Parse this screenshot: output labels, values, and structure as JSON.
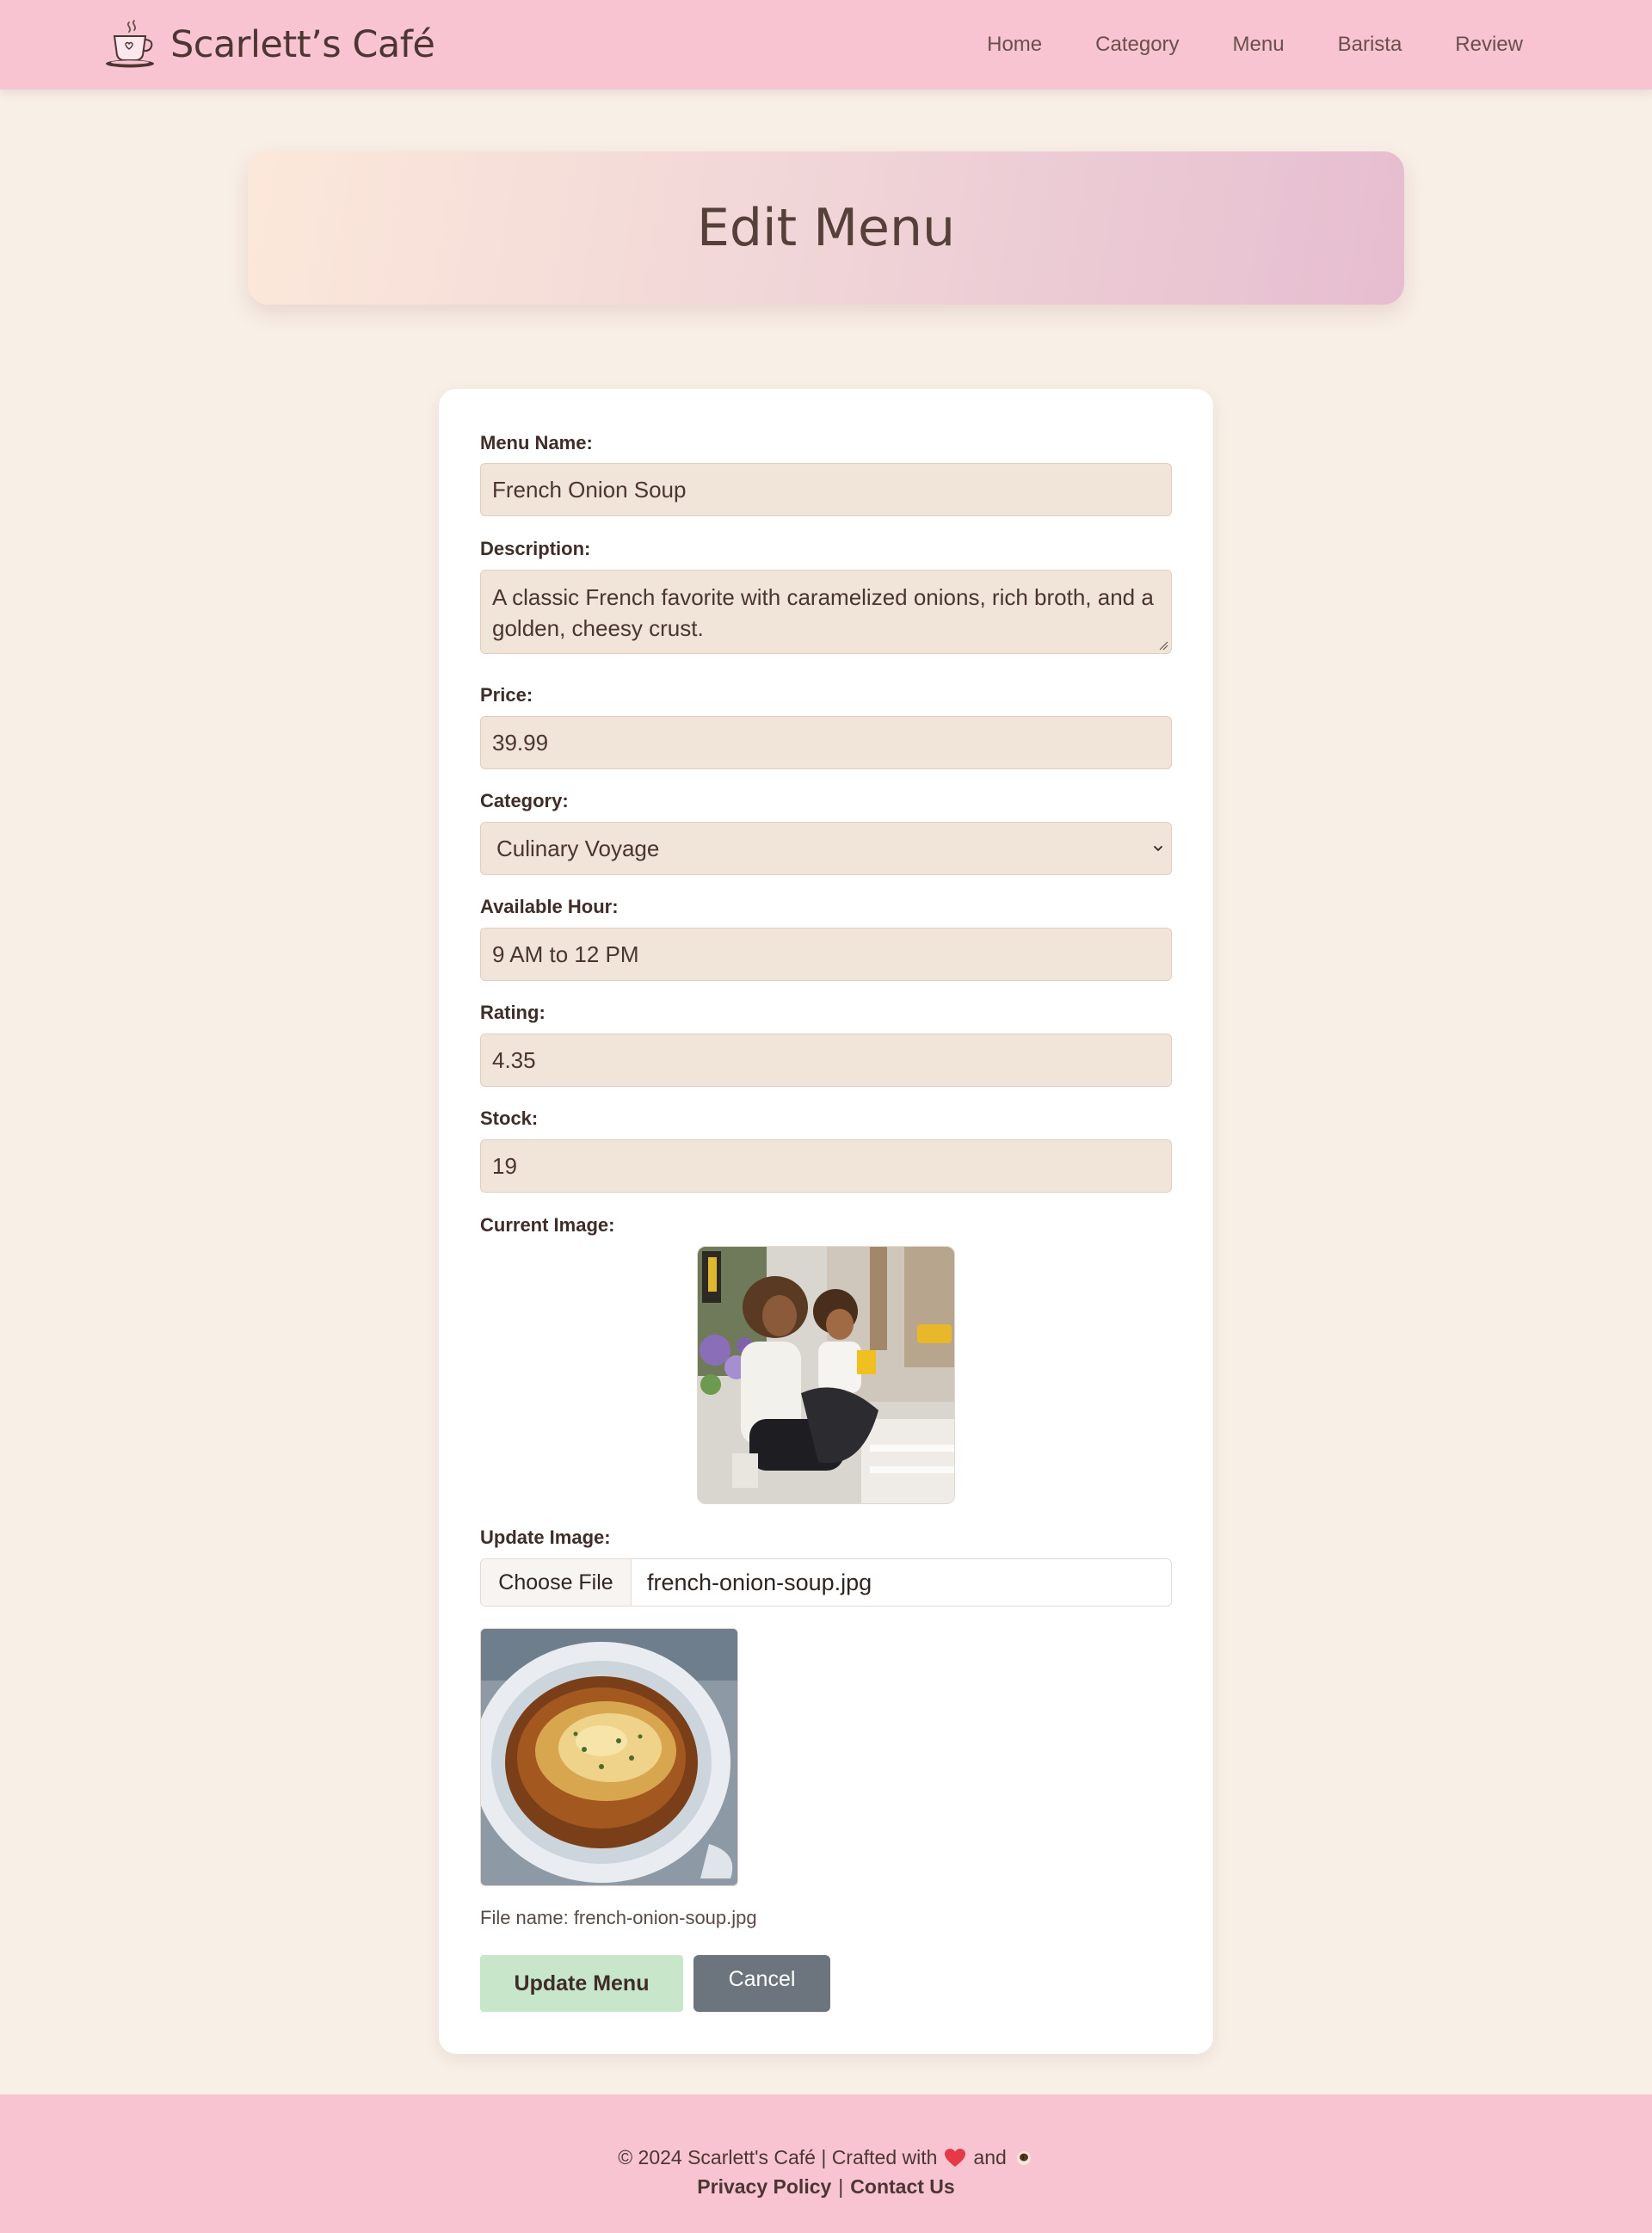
{
  "brand": {
    "title": "Scarlett’s Café",
    "icon": "coffee-cup-icon"
  },
  "nav": {
    "items": [
      {
        "label": "Home"
      },
      {
        "label": "Category"
      },
      {
        "label": "Menu"
      },
      {
        "label": "Barista"
      },
      {
        "label": "Review"
      }
    ]
  },
  "hero": {
    "title": "Edit Menu"
  },
  "form": {
    "menu_name": {
      "label": "Menu Name:",
      "value": "French Onion Soup"
    },
    "description": {
      "label": "Description:",
      "value": "A classic French favorite with caramelized onions, rich broth, and a golden, cheesy crust."
    },
    "price": {
      "label": "Price:",
      "value": "39.99"
    },
    "category": {
      "label": "Category:",
      "value": "Culinary Voyage"
    },
    "available_hour": {
      "label": "Available Hour:",
      "value": "9 AM to 12 PM"
    },
    "rating": {
      "label": "Rating:",
      "value": "4.35"
    },
    "stock": {
      "label": "Stock:",
      "value": "19"
    },
    "current_image": {
      "label": "Current Image:"
    },
    "update_image": {
      "label": "Update Image:",
      "button_label": "Choose File",
      "file_name": "french-onion-soup.jpg",
      "caption": "File name: french-onion-soup.jpg"
    },
    "buttons": {
      "update": "Update Menu",
      "cancel": "Cancel"
    }
  },
  "footer": {
    "prefix": "© 2024 Scarlett's Café | Crafted with",
    "and": "and",
    "separator": "|",
    "privacy": "Privacy Policy",
    "contact": "Contact Us"
  },
  "colors": {
    "navbar_bg": "#f8c4d2",
    "page_bg": "#f8efe6",
    "input_bg": "#f1e4d8",
    "update_button": "#c8e6c9",
    "cancel_button": "#6c757d",
    "heart": "#e53945"
  }
}
